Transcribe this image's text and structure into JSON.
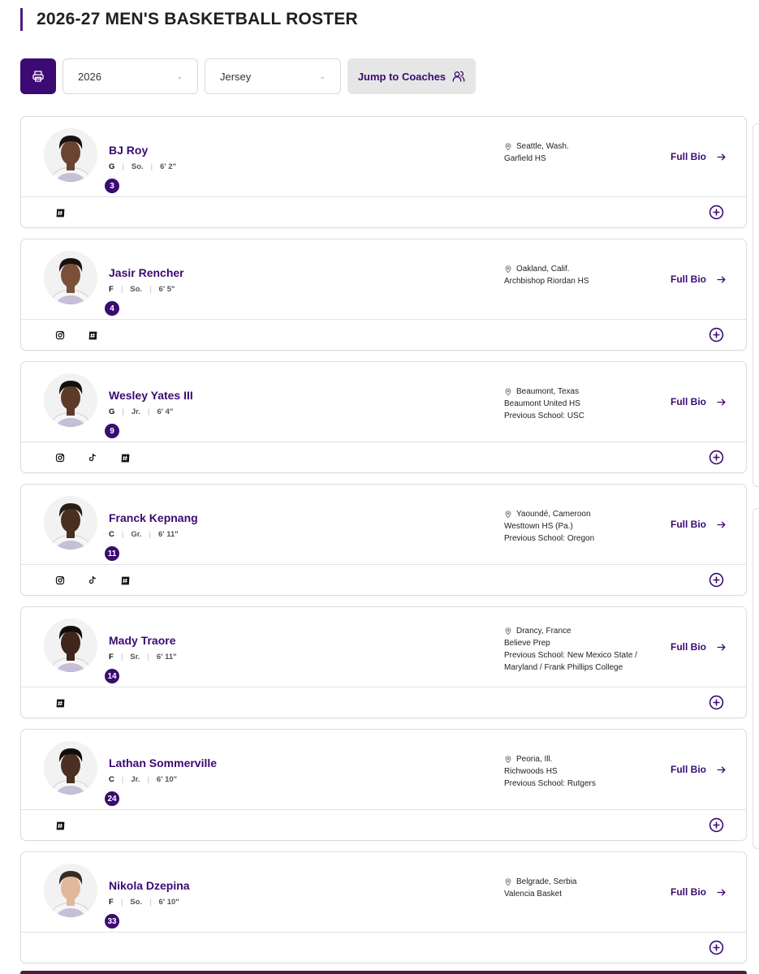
{
  "page": {
    "title": "2026-27 MEN'S BASKETBALL ROSTER"
  },
  "toolbar": {
    "print_icon": "printer-icon",
    "season_value": "2026",
    "sort_value": "Jersey",
    "jump_label": "Jump to Coaches",
    "jump_icon": "users-icon"
  },
  "colors": {
    "accent": "#3b0a72",
    "border": "#dcdcdc"
  },
  "players": [
    {
      "name": "BJ Roy",
      "number": "3",
      "position": "G",
      "class": "So.",
      "height": "6' 2\"",
      "hometown": "Seattle, Wash.",
      "school": "Garfield HS",
      "previous": "",
      "socials": [
        "hashtag"
      ],
      "bio": "Full Bio",
      "skin": "#6b4431",
      "hair": "#1a1210"
    },
    {
      "name": "Jasir Rencher",
      "number": "4",
      "position": "F",
      "class": "So.",
      "height": "6' 5\"",
      "hometown": "Oakland, Calif.",
      "school": "Archbishop Riordan HS",
      "previous": "",
      "socials": [
        "instagram",
        "hashtag"
      ],
      "bio": "Full Bio",
      "skin": "#7a5039",
      "hair": "#1a1210"
    },
    {
      "name": "Wesley Yates III",
      "number": "9",
      "position": "G",
      "class": "Jr.",
      "height": "6' 4\"",
      "hometown": "Beaumont, Texas",
      "school": "Beaumont United HS",
      "previous": "Previous School: USC",
      "socials": [
        "instagram",
        "tiktok",
        "hashtag"
      ],
      "bio": "Full Bio",
      "skin": "#5e3a28",
      "hair": "#151010"
    },
    {
      "name": "Franck Kepnang",
      "number": "11",
      "position": "C",
      "class": "Gr.",
      "height": "6' 11\"",
      "hometown": "Yaoundé, Cameroon",
      "school": "Westtown HS (Pa.)",
      "previous": "Previous School: Oregon",
      "socials": [
        "instagram",
        "tiktok",
        "hashtag"
      ],
      "bio": "Full Bio",
      "skin": "#4a2e20",
      "hair": "#2a1d17"
    },
    {
      "name": "Mady Traore",
      "number": "14",
      "position": "F",
      "class": "Sr.",
      "height": "6' 11\"",
      "hometown": "Drancy, France",
      "school": "Believe Prep",
      "previous": "Previous School: New Mexico State / Maryland / Frank Phillips College",
      "socials": [
        "hashtag"
      ],
      "bio": "Full Bio",
      "skin": "#3e261b",
      "hair": "#120c0a"
    },
    {
      "name": "Lathan Sommerville",
      "number": "24",
      "position": "C",
      "class": "Jr.",
      "height": "6' 10\"",
      "hometown": "Peoria, Ill.",
      "school": "Richwoods HS",
      "previous": "Previous School: Rutgers",
      "socials": [
        "hashtag"
      ],
      "bio": "Full Bio",
      "skin": "#4b2f22",
      "hair": "#120c0a"
    },
    {
      "name": "Nikola Dzepina",
      "number": "33",
      "position": "F",
      "class": "So.",
      "height": "6' 10\"",
      "hometown": "Belgrade, Serbia",
      "school": "Valencia Basket",
      "previous": "",
      "socials": [],
      "bio": "Full Bio",
      "skin": "#e2b89c",
      "hair": "#3b2b22"
    }
  ]
}
